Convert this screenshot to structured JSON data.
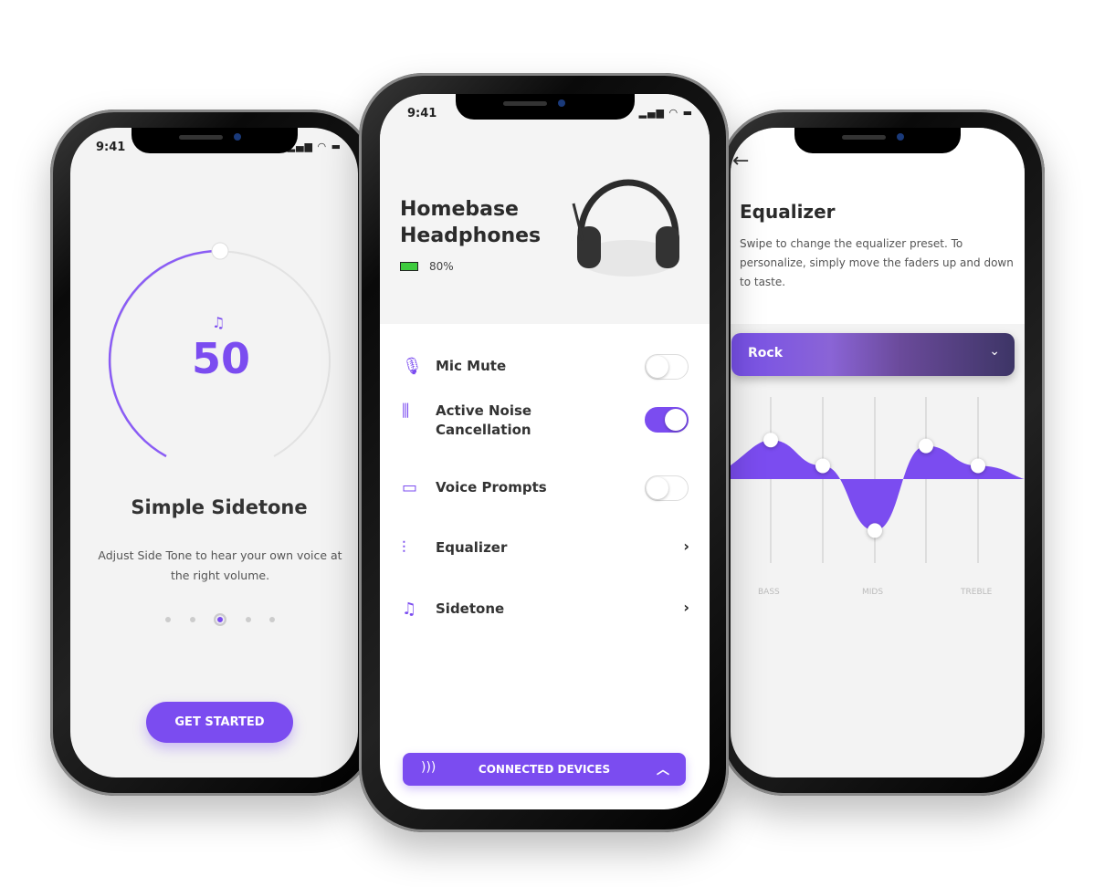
{
  "accent": "#7b4cf0",
  "status_bar": {
    "time": "9:41"
  },
  "sidetone_screen": {
    "value": "50",
    "value_fraction": 0.5,
    "title": "Simple Sidetone",
    "description": "Adjust Side Tone to hear your own voice at the right volume.",
    "pager": {
      "count": 5,
      "active_index": 2
    },
    "cta": "GET STARTED",
    "icon": "sidetone-icon"
  },
  "home_screen": {
    "device_name_line1": "Homebase",
    "device_name_line2": "Headphones",
    "battery": "80%",
    "battery_color": "#3ecb3e",
    "settings": [
      {
        "label": "Mic Mute",
        "icon": "mic-mute-icon",
        "type": "toggle",
        "on": false
      },
      {
        "label": "Active Noise Cancellation",
        "icon": "waveform-icon",
        "type": "toggle",
        "on": true
      },
      {
        "label": "Voice Prompts",
        "icon": "speech-bubble-icon",
        "type": "toggle",
        "on": false
      },
      {
        "label": "Equalizer",
        "icon": "equalizer-icon",
        "type": "link"
      },
      {
        "label": "Sidetone",
        "icon": "sidetone-icon",
        "type": "link"
      }
    ],
    "connected_devices": "CONNECTED DEVICES"
  },
  "equalizer_screen": {
    "title": "Equalizer",
    "description": "Swipe to change the equalizer preset. To personalize, simply move the faders up and down to taste.",
    "preset": "Rock",
    "band_labels": [
      "BASS",
      "MIDS",
      "TREBLE"
    ],
    "fader_levels": [
      0.47,
      0.16,
      -0.62,
      0.4,
      0.16
    ]
  }
}
